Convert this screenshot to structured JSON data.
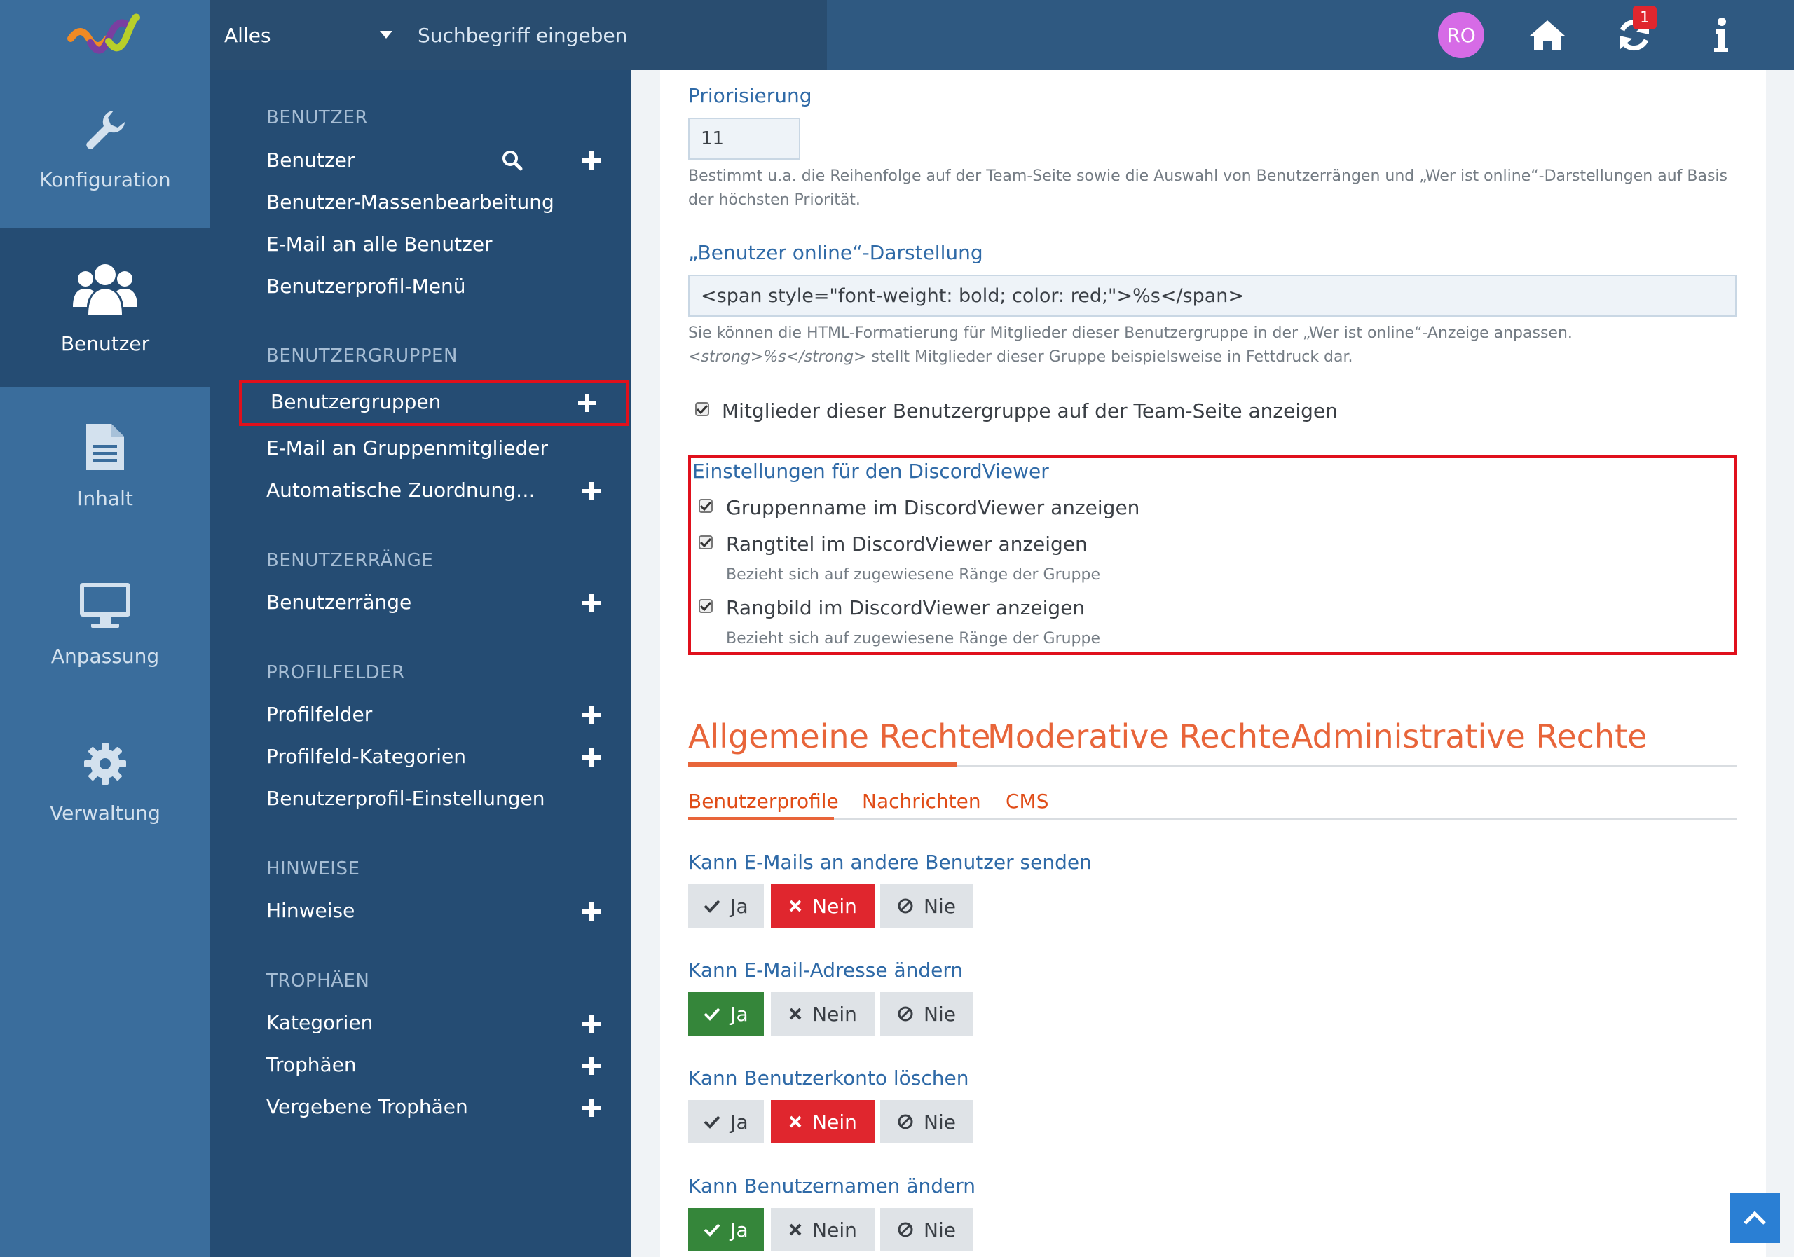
{
  "topbar": {
    "search_scope": "Alles",
    "search_placeholder": "Suchbegriff eingeben",
    "avatar_initials": "RO",
    "notification_count": "1"
  },
  "rail": [
    {
      "label": "Konfiguration",
      "icon": "wrench-icon"
    },
    {
      "label": "Benutzer",
      "icon": "users-icon",
      "active": true
    },
    {
      "label": "Inhalt",
      "icon": "document-icon"
    },
    {
      "label": "Anpassung",
      "icon": "monitor-icon"
    },
    {
      "label": "Verwaltung",
      "icon": "gear-icon"
    }
  ],
  "menu": {
    "sections": [
      {
        "title": "BENUTZER",
        "items": [
          "Benutzer",
          "Benutzer-Massenbearbeitung",
          "E-Mail an alle Benutzer",
          "Benutzerprofil-Menü"
        ]
      },
      {
        "title": "BENUTZERGRUPPEN",
        "items": [
          "Benutzergruppen",
          "E-Mail an Gruppenmitglieder",
          "Automatische Zuordnung…"
        ]
      },
      {
        "title": "BENUTZERRÄNGE",
        "items": [
          "Benutzerränge"
        ]
      },
      {
        "title": "PROFILFELDER",
        "items": [
          "Profilfelder",
          "Profilfeld-Kategorien",
          "Benutzerprofil-Einstellungen"
        ]
      },
      {
        "title": "HINWEISE",
        "items": [
          "Hinweise"
        ]
      },
      {
        "title": "TROPHÄEN",
        "items": [
          "Kategorien",
          "Trophäen",
          "Vergebene Trophäen"
        ]
      }
    ]
  },
  "form": {
    "priority_label": "Priorisierung",
    "priority_value": "11",
    "priority_desc_1": "Bestimmt u.a. die Reihenfolge auf der Team-Seite sowie die Auswahl von Benutzerrängen und „Wer ist online“-Darstellungen auf Basis",
    "priority_desc_2": "der höchsten Priorität.",
    "online_label": "„Benutzer online“-Darstellung",
    "online_value": "<span style=\"font-weight: bold; color: red;\">%s</span>",
    "online_desc_1": "Sie können die HTML-Formatierung für Mitglieder dieser Benutzergruppe in der „Wer ist online“-Anzeige anpassen.",
    "online_desc_2_em": "<strong>%s</strong>",
    "online_desc_2_rest": " stellt Mitglieder dieser Gruppe beispielsweise in Fettdruck dar.",
    "team_checkbox": "Mitglieder dieser Benutzergruppe auf der Team-Seite anzeigen",
    "discord_title": "Einstellungen für den DiscordViewer",
    "discord_opt1": "Gruppenname im DiscordViewer anzeigen",
    "discord_opt2": "Rangtitel im DiscordViewer anzeigen",
    "discord_opt2_desc": "Bezieht sich auf zugewiesene Ränge der Gruppe",
    "discord_opt3": "Rangbild im DiscordViewer anzeigen",
    "discord_opt3_desc": "Bezieht sich auf zugewiesene Ränge der Gruppe"
  },
  "tabs": {
    "main": [
      "Allgemeine Rechte",
      "Moderative Rechte",
      "Administrative Rechte"
    ],
    "sub": [
      "Benutzerprofile",
      "Nachrichten",
      "CMS"
    ]
  },
  "permissions": {
    "button_labels": {
      "yes": "Ja",
      "no": "Nein",
      "never": "Nie"
    },
    "items": [
      {
        "label": "Kann E-Mails an andere Benutzer senden",
        "selected": "Nein"
      },
      {
        "label": "Kann E-Mail-Adresse ändern",
        "selected": "Ja"
      },
      {
        "label": "Kann Benutzerkonto löschen",
        "selected": "Nein"
      },
      {
        "label": "Kann Benutzernamen ändern",
        "selected": "Ja"
      }
    ]
  },
  "colors": {
    "topbar": "#2f5981",
    "rail": "#3a6d9c",
    "menu": "#254c73",
    "accent_tab": "#e8653a",
    "highlight_box": "#e0101c",
    "yes_active": "#35863a",
    "no_active": "#e0262e"
  }
}
